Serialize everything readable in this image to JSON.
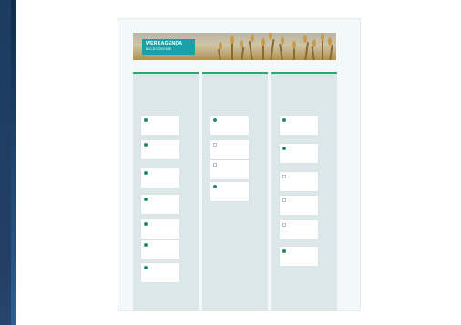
{
  "banner": {
    "title": "WERKAGENDA",
    "subtitle": "BIO-ECONOMIE"
  },
  "colors": {
    "accent": "#19a0a8",
    "column_bar": "#32a56f",
    "dot": "#2a8a66"
  },
  "columns": [
    {
      "step": "",
      "title": "",
      "cards": [
        {
          "marker": "dot",
          "text": ""
        },
        {
          "marker": "dot",
          "text": ""
        },
        {
          "marker": "dot",
          "text": ""
        },
        {
          "marker": "dot",
          "text": ""
        },
        {
          "marker": "dot",
          "text": ""
        },
        {
          "marker": "dot",
          "text": ""
        },
        {
          "marker": "dot",
          "text": ""
        }
      ]
    },
    {
      "step": "",
      "title": "",
      "cards": [
        {
          "marker": "dot",
          "text": ""
        },
        {
          "marker": "square",
          "text": ""
        },
        {
          "marker": "square",
          "text": ""
        },
        {
          "marker": "dot",
          "text": ""
        }
      ]
    },
    {
      "step": "",
      "title": "",
      "cards": [
        {
          "marker": "dot",
          "text": ""
        },
        {
          "marker": "dot",
          "text": ""
        },
        {
          "marker": "square",
          "text": ""
        },
        {
          "marker": "square",
          "text": ""
        },
        {
          "marker": "square",
          "text": ""
        },
        {
          "marker": "dot",
          "text": ""
        }
      ]
    }
  ]
}
